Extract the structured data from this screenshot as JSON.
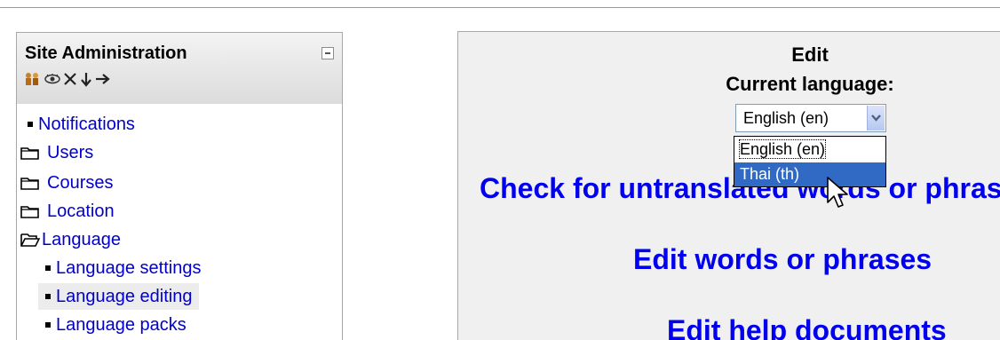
{
  "site_admin": {
    "title": "Site Administration",
    "header_icons": [
      "assign-roles-icon",
      "eye-icon",
      "delete-icon",
      "move-down-icon",
      "move-right-icon"
    ],
    "items": [
      {
        "label": "Notifications",
        "kind": "bullet",
        "level": 0
      },
      {
        "label": "Users",
        "kind": "folder-closed",
        "level": 0
      },
      {
        "label": "Courses",
        "kind": "folder-closed",
        "level": 0
      },
      {
        "label": "Location",
        "kind": "folder-closed",
        "level": 0
      },
      {
        "label": "Language",
        "kind": "folder-open",
        "level": 0
      },
      {
        "label": "Language settings",
        "kind": "bullet",
        "level": 1
      },
      {
        "label": "Language editing",
        "kind": "bullet",
        "level": 1,
        "selected": true
      },
      {
        "label": "Language packs",
        "kind": "bullet",
        "level": 1
      }
    ]
  },
  "main": {
    "edit_heading": "Edit",
    "current_language_label": "Current language:",
    "language_select": {
      "value": "English (en)",
      "options": [
        "English (en)",
        "Thai (th)"
      ],
      "highlighted": "Thai (th)"
    },
    "links": {
      "check_untranslated": "Check for untranslated words or phrases",
      "edit_words": "Edit words or phrases",
      "edit_help": "Edit help documents"
    }
  },
  "colors": {
    "link": "#0000ee",
    "nav_link": "#0000cc",
    "highlight": "#316ac5",
    "panel_bg": "#f0f0f0"
  }
}
